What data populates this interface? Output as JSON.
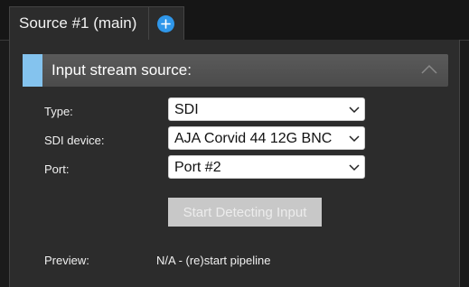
{
  "tabs": {
    "active_label": "Source #1 (main)",
    "add_icon": "plus-circle-icon"
  },
  "section": {
    "title": "Input stream source:",
    "accent_color": "#84c3ee",
    "collapse_icon": "chevron-up-icon"
  },
  "form": {
    "type": {
      "label": "Type:",
      "value": "SDI"
    },
    "device": {
      "label": "SDI device:",
      "value": "AJA Corvid 44 12G BNC"
    },
    "port": {
      "label": "Port:",
      "value": "Port #2"
    },
    "detect_button": "Start Detecting Input",
    "preview": {
      "label": "Preview:",
      "value": "N/A - (re)start pipeline"
    }
  }
}
